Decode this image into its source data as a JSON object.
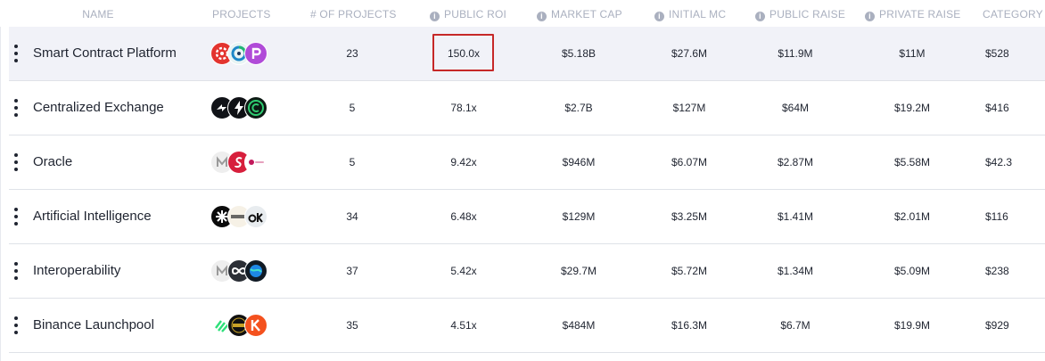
{
  "columns": {
    "name": "NAME",
    "projects": "PROJECTS",
    "num_projects": "# OF PROJECTS",
    "public_roi": "PUBLIC ROI",
    "market_cap": "MARKET CAP",
    "initial_mc": "INITIAL MC",
    "public_raise": "PUBLIC RAISE",
    "private_raise": "PRIVATE RAISE",
    "category": "CATEGORY"
  },
  "info_glyph": "i",
  "rows": [
    {
      "name": "Smart Contract Platform",
      "num_projects": "23",
      "public_roi": "150.0x",
      "market_cap": "$5.18B",
      "initial_mc": "$27.6M",
      "public_raise": "$11.9M",
      "private_raise": "$11M",
      "category": "$528"
    },
    {
      "name": "Centralized Exchange",
      "num_projects": "5",
      "public_roi": "78.1x",
      "market_cap": "$2.7B",
      "initial_mc": "$127M",
      "public_raise": "$64M",
      "private_raise": "$19.2M",
      "category": "$416"
    },
    {
      "name": "Oracle",
      "num_projects": "5",
      "public_roi": "9.42x",
      "market_cap": "$946M",
      "initial_mc": "$6.07M",
      "public_raise": "$2.87M",
      "private_raise": "$5.58M",
      "category": "$42.3"
    },
    {
      "name": "Artificial Intelligence",
      "num_projects": "34",
      "public_roi": "6.48x",
      "market_cap": "$129M",
      "initial_mc": "$3.25M",
      "public_raise": "$1.41M",
      "private_raise": "$2.01M",
      "category": "$116"
    },
    {
      "name": "Interoperability",
      "num_projects": "37",
      "public_roi": "5.42x",
      "market_cap": "$29.7M",
      "initial_mc": "$5.72M",
      "public_raise": "$1.34M",
      "private_raise": "$5.09M",
      "category": "$238"
    },
    {
      "name": "Binance Launchpool",
      "num_projects": "35",
      "public_roi": "4.51x",
      "market_cap": "$484M",
      "initial_mc": "$16.3M",
      "public_raise": "$6.7M",
      "private_raise": "$19.9M",
      "category": "$929"
    }
  ],
  "colors": {
    "highlight_border": "#c62828",
    "header_text": "#aab0bf",
    "row_border": "#dfe2e8",
    "selected_row_bg": "#f1f2f8"
  },
  "logo_icons": [
    [
      "red-gear-token-icon",
      "blue-green-ring-token-icon",
      "purple-p-token-icon"
    ],
    [
      "black-arrows-token-icon",
      "black-bolt-token-icon",
      "green-c-ring-token-icon"
    ],
    [
      "grey-m-token-icon",
      "red-s-token-icon",
      "pink-dot-token-icon"
    ],
    [
      "black-asterisk-token-icon",
      "wordmark-token-icon",
      "ok-token-icon"
    ],
    [
      "grey-m-token-icon",
      "infinity-token-icon",
      "blue-globe-token-icon"
    ],
    [
      "green-stripes-token-icon",
      "black-gold-token-icon",
      "orange-k-token-icon"
    ]
  ]
}
